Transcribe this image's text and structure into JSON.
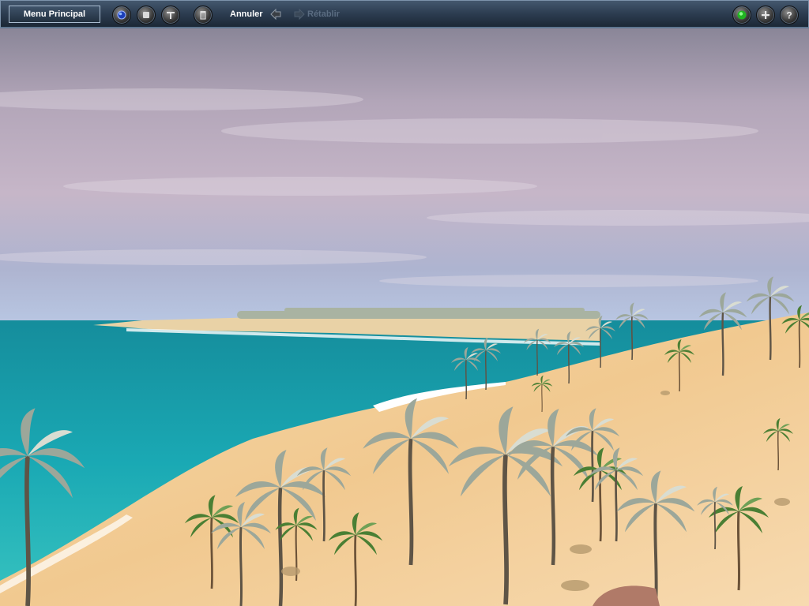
{
  "toolbar": {
    "menu_label": "Menu Principal",
    "undo_label": "Annuler",
    "redo_label": "Rétablir",
    "left_icons": [
      "globe-icon",
      "stop-icon",
      "tools-icon",
      "trash-icon"
    ],
    "right_icons": [
      "status-light-icon",
      "plus-icon",
      "help-icon"
    ],
    "help_glyph": "?",
    "accent_color": "#2f4257",
    "status_color": "#2fd02f"
  },
  "scene": {
    "description_colors": {
      "sky_top": "#8c8a9b",
      "sky_mid": "#c8b6c6",
      "sea": "#1aa8b4",
      "sand": "#f2cf9a",
      "palm_leaf": "#4f8c3a"
    }
  }
}
